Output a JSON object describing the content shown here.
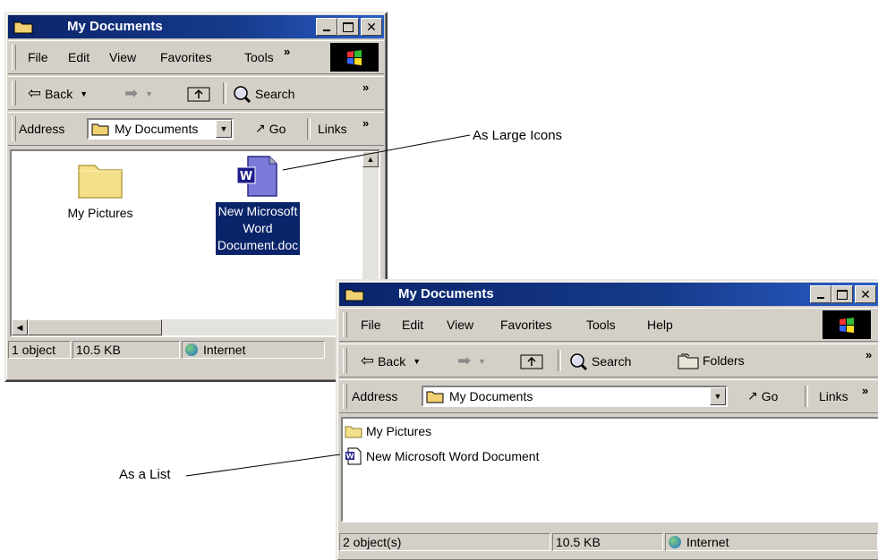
{
  "window_icons": {
    "title": "My Documents",
    "menu": [
      "File",
      "Edit",
      "View",
      "Favorites",
      "Tools"
    ],
    "more": "»",
    "toolbar": {
      "back": "Back",
      "search": "Search"
    },
    "address": {
      "label": "Address",
      "value": "My Documents",
      "go": "Go",
      "links": "Links"
    },
    "items": [
      {
        "name": "My Pictures",
        "icon": "folder-icon"
      },
      {
        "name_lines": [
          "New Microsoft",
          "Word",
          "Document.doc"
        ],
        "icon": "word-doc-icon",
        "selected": true
      }
    ],
    "status": {
      "objects": "1 object",
      "size": "10.5 KB",
      "zone": "Internet"
    }
  },
  "window_list": {
    "title": "My Documents",
    "menu": [
      "File",
      "Edit",
      "View",
      "Favorites",
      "Tools",
      "Help"
    ],
    "more": "»",
    "toolbar": {
      "back": "Back",
      "search": "Search",
      "folders": "Folders"
    },
    "address": {
      "label": "Address",
      "value": "My Documents",
      "go": "Go",
      "links": "Links"
    },
    "items": [
      {
        "name": "My Pictures",
        "icon": "folder-icon"
      },
      {
        "name": "New Microsoft Word Document",
        "icon": "word-doc-icon"
      }
    ],
    "status": {
      "objects": "2 object(s)",
      "size": "10.5 KB",
      "zone": "Internet"
    }
  },
  "callouts": {
    "large_icons": "As Large Icons",
    "list": "As a List"
  },
  "colors": {
    "titlebar": "#0a246a",
    "face": "#d4d0c8",
    "selection": "#0a246a"
  }
}
